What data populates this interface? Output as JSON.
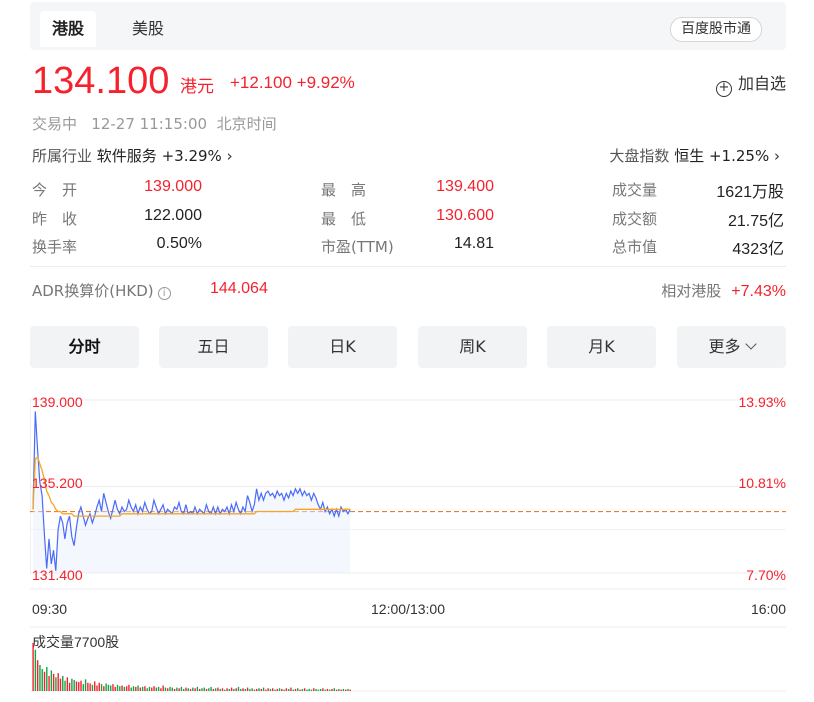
{
  "tabs": [
    {
      "label": "港股",
      "active": true
    },
    {
      "label": "美股",
      "active": false
    }
  ],
  "baidu_button": "百度股市通",
  "quote": {
    "price": "134.100",
    "currency": "港元",
    "change": "+12.100 +9.92%",
    "add_label": "加自选"
  },
  "status": "交易中   12-27 11:15:00  北京时间",
  "industry": {
    "label": "所属行业",
    "name": "软件服务",
    "change": "+3.29%"
  },
  "index": {
    "label": "大盘指数",
    "name": "恒生",
    "change": "+1.25%"
  },
  "stats": [
    [
      {
        "label": "今　开",
        "value": "139.000",
        "up": true
      },
      {
        "label": "最　高",
        "value": "139.400",
        "up": true
      },
      {
        "label": "成交量",
        "value": "1621万股",
        "up": false
      }
    ],
    [
      {
        "label": "昨　收",
        "value": "122.000",
        "up": false
      },
      {
        "label": "最　低",
        "value": "130.600",
        "up": true
      },
      {
        "label": "成交额",
        "value": "21.75亿",
        "up": false
      }
    ],
    [
      {
        "label": "换手率",
        "value": "0.50%",
        "up": false
      },
      {
        "label": "市盈(TTM)",
        "value": "14.81",
        "up": false
      },
      {
        "label": "总市值",
        "value": "4323亿",
        "up": false
      }
    ]
  ],
  "adr": {
    "label": "ADR换算价(HKD)",
    "info": "i",
    "value": "144.064"
  },
  "relative": {
    "label": "相对港股",
    "value": "+7.43%"
  },
  "periods": [
    "分时",
    "五日",
    "日K",
    "周K",
    "月K",
    "更多"
  ],
  "colors": {
    "up": "#f5222d",
    "down": "#15a34a",
    "price_line": "#4a6cf7",
    "avg_line": "#f5a623"
  },
  "chart_data": {
    "type": "line",
    "y_left_labels": [
      "139.000",
      "135.200",
      "131.400"
    ],
    "y_right_labels": [
      "13.93%",
      "10.81%",
      "7.70%"
    ],
    "x_labels": [
      "09:30",
      "12:00/13:00",
      "16:00"
    ],
    "ylim": [
      131.4,
      139.0
    ],
    "prev_close": 122.0,
    "reference_price": 134.1,
    "total_minutes": 330,
    "volume_label": "成交量7700股",
    "series": [
      {
        "values": [
          134.2,
          138.5,
          136.8,
          135.4,
          134.8,
          133.1,
          131.6,
          132.9,
          131.8,
          132.4,
          131.5,
          133.3,
          133.9,
          133.6,
          132.9,
          133.6,
          133.9,
          133.0,
          132.6,
          133.4,
          134.0,
          134.3,
          133.9,
          133.5,
          133.8,
          134.0,
          133.6,
          133.9,
          134.3,
          134.6,
          134.1,
          134.9,
          134.5,
          134.1,
          133.8,
          134.2,
          134.6,
          134.2,
          134.0,
          134.3,
          134.1,
          134.2,
          134.6,
          134.3,
          134.1,
          134.4,
          134.0,
          134.3,
          134.1,
          134.5,
          134.2,
          134.0,
          134.1,
          134.6,
          134.3,
          134.0,
          134.2,
          134.4,
          134.0,
          134.2,
          134.1,
          134.0,
          134.3,
          134.2,
          134.5,
          134.1,
          134.0,
          134.4,
          134.0,
          134.1,
          134.0,
          134.3,
          134.0,
          134.2,
          134.1,
          134.0,
          134.4,
          134.1,
          134.0,
          134.3,
          134.0,
          134.3,
          134.0,
          134.2,
          134.1,
          134.3,
          134.0,
          134.4,
          134.1,
          134.5,
          134.2,
          134.0,
          134.3,
          134.1,
          134.8,
          134.5,
          134.1,
          134.4,
          135.1,
          134.6,
          134.9,
          134.6,
          134.9,
          135.0,
          134.8,
          134.9,
          134.7,
          135.0,
          134.8,
          134.9,
          134.6,
          134.9,
          134.7,
          135.0,
          134.8,
          135.1,
          134.9,
          135.1,
          134.8,
          135.0,
          134.8,
          134.9,
          134.6,
          134.9,
          134.7,
          134.4,
          134.2,
          134.5,
          134.1,
          134.3,
          134.0,
          134.2,
          133.9,
          134.2,
          133.9,
          134.3,
          134.1,
          134.2,
          134.0,
          134.2
        ],
        "color": "#4a6cf7"
      },
      {
        "values": [
          134.2,
          136.4,
          136.5,
          136.2,
          135.9,
          135.5,
          135.0,
          134.8,
          134.5,
          134.4,
          134.2,
          134.1,
          134.1,
          134.0,
          134.0,
          134.0,
          134.0,
          134.0,
          133.9,
          133.9,
          133.9,
          133.9,
          133.9,
          133.9,
          133.9,
          133.9,
          133.9,
          133.9,
          133.9,
          133.9,
          133.9,
          133.9,
          133.9,
          133.9,
          133.9,
          133.9,
          133.9,
          133.9,
          133.9,
          134.0,
          134.0,
          134.0,
          134.0,
          134.0,
          134.0,
          134.0,
          134.0,
          134.0,
          134.0,
          134.0,
          134.0,
          134.0,
          134.0,
          134.0,
          134.0,
          134.0,
          134.0,
          134.0,
          134.0,
          134.0,
          134.0,
          134.0,
          134.0,
          134.0,
          134.0,
          134.0,
          134.0,
          134.0,
          134.0,
          134.0,
          134.0,
          134.0,
          134.0,
          134.0,
          134.0,
          134.0,
          134.0,
          134.0,
          134.0,
          134.0,
          134.0,
          134.0,
          134.0,
          134.0,
          134.0,
          134.0,
          134.0,
          134.0,
          134.0,
          134.0,
          134.0,
          134.0,
          134.0,
          134.0,
          134.0,
          134.0,
          134.0,
          134.0,
          134.1,
          134.1,
          134.1,
          134.1,
          134.1,
          134.1,
          134.1,
          134.1,
          134.1,
          134.1,
          134.1,
          134.1,
          134.1,
          134.1,
          134.1,
          134.1,
          134.1,
          134.2,
          134.2,
          134.2,
          134.2,
          134.2,
          134.2,
          134.2,
          134.2,
          134.2,
          134.2,
          134.2,
          134.2,
          134.2,
          134.2,
          134.2,
          134.2,
          134.2,
          134.2,
          134.2,
          134.2,
          134.2,
          134.2,
          134.2,
          134.2,
          134.2
        ],
        "color": "#f5a623"
      }
    ],
    "volume": [
      70,
      60,
      45,
      38,
      32,
      28,
      35,
      22,
      30,
      25,
      20,
      26,
      18,
      22,
      15,
      20,
      12,
      18,
      16,
      14,
      13,
      15,
      10,
      17,
      12,
      11,
      9,
      14,
      8,
      12,
      10,
      7,
      11,
      9,
      8,
      10,
      6,
      9,
      7,
      8,
      6,
      7,
      9,
      5,
      7,
      6,
      8,
      5,
      6,
      7,
      4,
      6,
      5,
      7,
      5,
      6,
      4,
      8,
      5,
      4,
      6,
      5,
      3,
      5,
      4,
      6,
      3,
      5,
      4,
      3,
      5,
      4,
      6,
      3,
      4,
      5,
      3,
      4,
      6,
      3,
      4,
      5,
      3,
      4,
      2,
      4,
      3,
      5,
      3,
      4,
      6,
      3,
      4,
      3,
      5,
      3,
      4,
      2,
      3,
      4,
      3,
      5,
      2,
      4,
      3,
      4,
      2,
      3,
      4,
      3,
      2,
      4,
      3,
      5,
      2,
      3,
      4,
      2,
      3,
      4,
      2,
      3,
      2,
      4,
      3,
      2,
      3,
      4,
      2,
      3,
      2,
      3,
      4,
      2,
      3,
      2,
      3,
      2,
      3,
      2
    ],
    "volume_up": [
      1,
      0,
      1,
      0,
      0,
      1,
      0,
      1,
      0,
      1,
      0,
      1,
      1,
      0,
      0,
      1,
      1,
      0,
      0,
      1,
      1,
      1,
      0,
      0,
      1,
      1,
      0,
      1,
      1,
      1,
      0,
      1,
      0,
      0,
      0,
      1,
      1,
      0,
      0,
      1,
      0,
      1,
      1,
      0,
      0,
      1,
      0,
      1,
      0,
      1,
      0,
      0,
      1,
      1,
      0,
      0,
      1,
      1,
      0,
      1,
      0,
      0,
      1,
      0,
      1,
      0,
      0,
      1,
      0,
      1,
      0,
      1,
      0,
      1,
      0,
      0,
      1,
      0,
      0,
      1,
      0,
      1,
      0,
      1,
      0,
      1,
      0,
      1,
      0,
      1,
      0,
      0,
      1,
      0,
      1,
      0,
      0,
      1,
      1,
      0,
      1,
      0,
      1,
      1,
      0,
      1,
      0,
      1,
      0,
      1,
      0,
      1,
      0,
      1,
      0,
      1,
      0,
      1,
      0,
      1,
      0,
      0,
      0,
      1,
      0,
      0,
      0,
      1,
      0,
      1,
      0,
      1,
      0,
      1,
      0,
      1,
      0,
      1,
      0,
      1
    ]
  }
}
